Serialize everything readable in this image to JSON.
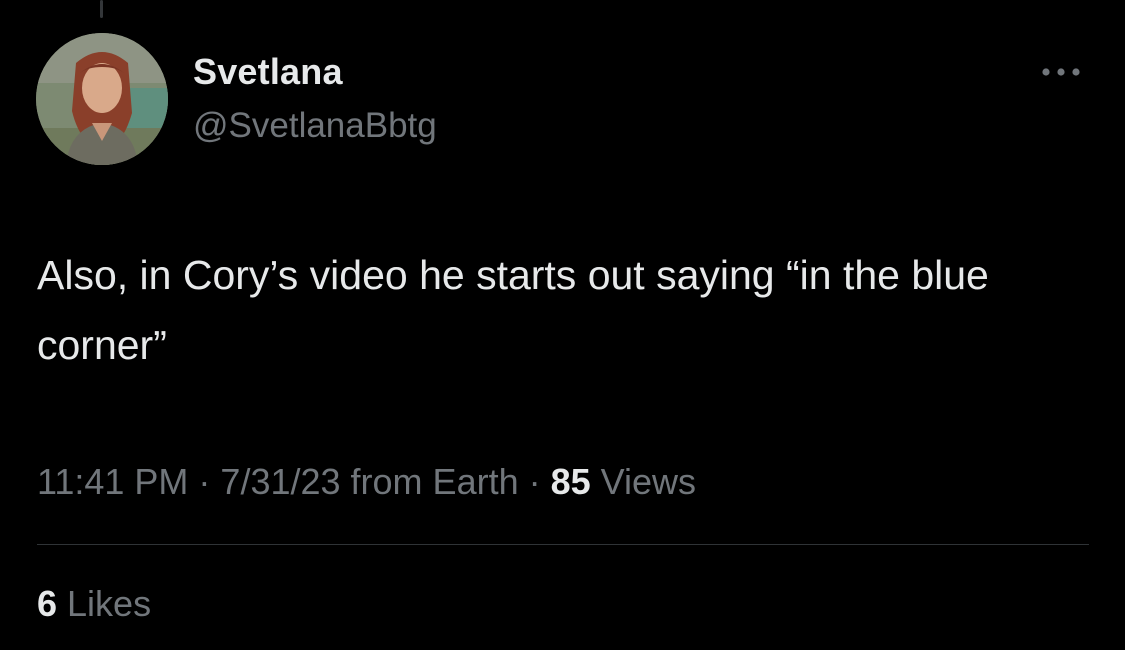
{
  "author": {
    "display_name": "Svetlana",
    "handle": "@SvetlanaBbtg",
    "avatar_icon": "user-avatar-photo"
  },
  "more_icon": "more-horizontal-icon",
  "tweet": {
    "text": "Also, in Cory’s video he starts out saying “in the blue corner”"
  },
  "meta": {
    "time": "11:41 PM",
    "sep1": " · ",
    "date": "7/31/23",
    "source": " from Earth",
    "sep2": " · ",
    "views_count": "85",
    "views_label": " Views"
  },
  "engagement": {
    "likes_count": "6",
    "likes_label": " Likes"
  },
  "colors": {
    "background": "#000000",
    "primary_text": "#e7e9ea",
    "secondary_text": "#71767b",
    "divider": "#2f3336"
  }
}
